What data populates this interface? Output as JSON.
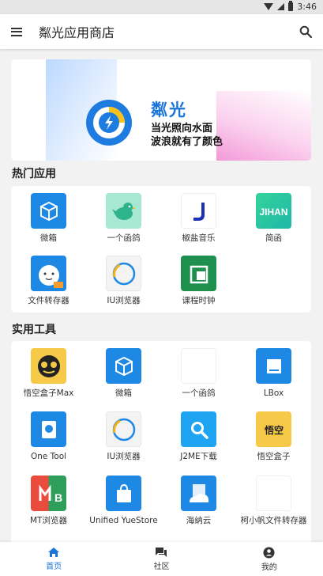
{
  "status_bar": {
    "time": "3:46"
  },
  "app_bar": {
    "title": "粼光应用商店"
  },
  "banner": {
    "brand": "粼光",
    "line1": "当光照向水面",
    "line2": "波浪就有了颜色"
  },
  "sections": [
    {
      "title": "热门应用",
      "apps": [
        {
          "label": "微箱",
          "icon": "cube-icon",
          "color": "#1e88e5"
        },
        {
          "label": "一个函鸽",
          "icon": "bird-icon",
          "color": "#9fe3cc"
        },
        {
          "label": "椒盐音乐",
          "icon": "music-j-icon",
          "color": "#ffffff"
        },
        {
          "label": "简函",
          "icon": "jihan-logo-icon",
          "color": "#2bc49b"
        },
        {
          "label": "文件转存器",
          "icon": "cartoon-file-icon",
          "color": "#1e88e5"
        },
        {
          "label": "IU浏览器",
          "icon": "iu-browser-icon",
          "color": "#f3f3f3"
        },
        {
          "label": "课程时钟",
          "icon": "course-clock-icon",
          "color": "#1f8f4e"
        }
      ]
    },
    {
      "title": "实用工具",
      "apps": [
        {
          "label": "悟空盒子Max",
          "icon": "wukong-max-icon",
          "color": "#f7c948"
        },
        {
          "label": "微箱",
          "icon": "cube-icon",
          "color": "#1e88e5"
        },
        {
          "label": "一个函鸽",
          "icon": "blank-icon",
          "color": "#ffffff"
        },
        {
          "label": "LBox",
          "icon": "lbox-icon",
          "color": "#1e88e5"
        },
        {
          "label": "One Tool",
          "icon": "one-tool-icon",
          "color": "#1e88e5"
        },
        {
          "label": "IU浏览器",
          "icon": "iu-browser-icon",
          "color": "#f3f3f3"
        },
        {
          "label": "J2ME下载",
          "icon": "j2me-search-icon",
          "color": "#1ea4f0"
        },
        {
          "label": "悟空盒子",
          "icon": "wukong-box-icon",
          "color": "#f7c948"
        },
        {
          "label": "MT浏览器",
          "icon": "mt-browser-icon",
          "color": "#e94b3c"
        },
        {
          "label": "Unified YueStore",
          "icon": "yuestore-bag-icon",
          "color": "#1e88e5"
        },
        {
          "label": "海纳云",
          "icon": "haina-cloud-icon",
          "color": "#1e88e5"
        },
        {
          "label": "柯小帆文件转存器",
          "icon": "blank-icon",
          "color": "#ffffff"
        }
      ]
    }
  ],
  "bottom_nav": [
    {
      "label": "首页",
      "icon": "home-icon",
      "active": true
    },
    {
      "label": "社区",
      "icon": "forum-icon",
      "active": false
    },
    {
      "label": "我的",
      "icon": "account-icon",
      "active": false
    }
  ],
  "colors": {
    "accent": "#1c76d9",
    "background": "#f2f2f2"
  }
}
